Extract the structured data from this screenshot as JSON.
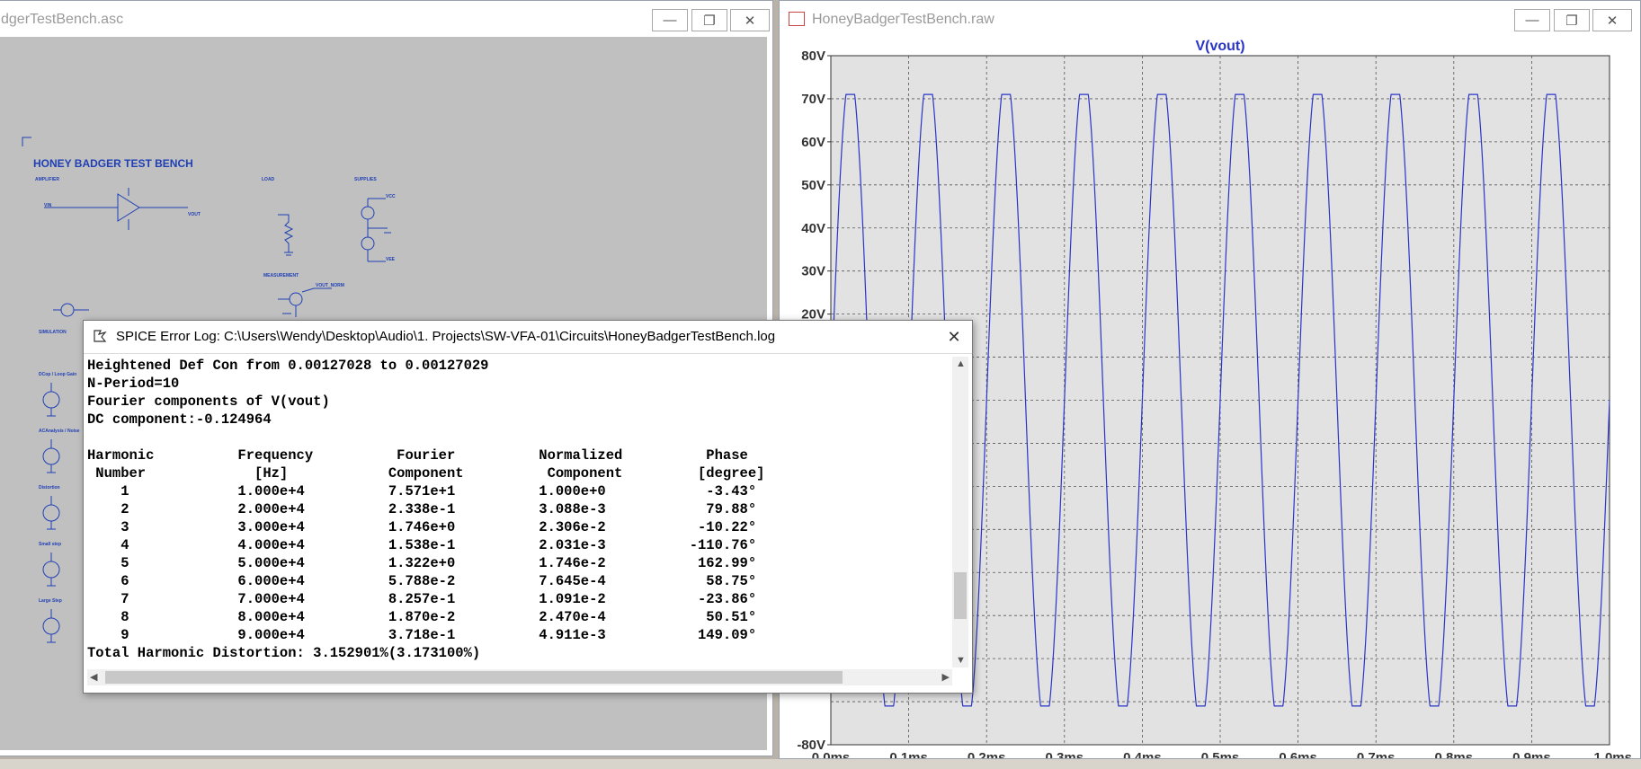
{
  "schematic_window": {
    "title": "dgerTestBench.asc",
    "texts": {
      "main_title": "HONEY BADGER TEST BENCH",
      "amplifier": "AMPLIFIER",
      "load": "LOAD",
      "supplies": "SUPPLIES",
      "measurement": "MEASUREMENT",
      "simulation": "SIMULATION",
      "dc_op": "DCop / Loop Gain",
      "ac_analysis": "ACAnalysis / Noise",
      "distortion": "Distortion",
      "small_step": "Small step",
      "large_step": "Large Step",
      "vin": "VIN",
      "vout": "VOUT",
      "vcc": "VCC",
      "vee": "VEE",
      "vout_norm": "VOUT_NORM"
    }
  },
  "waveform_window": {
    "title": "HoneyBadgerTestBench.raw",
    "trace_label": "V(vout)",
    "colors": {
      "trace": "#2a35c8",
      "label": "#2a35c8",
      "grid": "#555555",
      "plot_bg": "#e2e2e2"
    }
  },
  "chart_data": {
    "type": "line",
    "title": "V(vout)",
    "xlabel": "",
    "ylabel": "",
    "x_ticks": [
      "0.0ms",
      "0.1ms",
      "0.2ms",
      "0.3ms",
      "0.4ms",
      "0.5ms",
      "0.6ms",
      "0.7ms",
      "0.8ms",
      "0.9ms",
      "1.0ms"
    ],
    "y_ticks": [
      "80V",
      "70V",
      "60V",
      "50V",
      "40V",
      "30V",
      "20V",
      "-80V"
    ],
    "xlim": [
      0,
      1.0
    ],
    "ylim": [
      -80,
      80
    ],
    "grid": true,
    "series": [
      {
        "frequency_hz": 10000,
        "amplitude_v": 75.71,
        "clip_high_v": 71,
        "clip_low_v": -71,
        "color": "#2a35c8"
      }
    ]
  },
  "log_window": {
    "title": "SPICE Error Log: C:\\Users\\Wendy\\Desktop\\Audio\\1. Projects\\SW-VFA-01\\Circuits\\HoneyBadgerTestBench.log",
    "lines": [
      "Heightened Def Con from 0.00127028 to 0.00127029",
      "N-Period=10",
      "Fourier components of V(vout)",
      "DC component:-0.124964",
      "",
      "Harmonic          Frequency          Fourier          Normalized          Phase           ",
      " Number             [Hz]            Component          Component         [degree]",
      "    1             1.000e+4          7.571e+1          1.000e+0            -3.43°",
      "    2             2.000e+4          2.338e-1          3.088e-3            79.88°",
      "    3             3.000e+4          1.746e+0          2.306e-2           -10.22°",
      "    4             4.000e+4          1.538e-1          2.031e-3          -110.76°",
      "    5             5.000e+4          1.322e+0          1.746e-2           162.99°",
      "    6             6.000e+4          5.788e-2          7.645e-4            58.75°",
      "    7             7.000e+4          8.257e-1          1.091e-2           -23.86°",
      "    8             8.000e+4          1.870e-2          2.470e-4            50.51°",
      "    9             9.000e+4          3.718e-1          4.911e-3           149.09°",
      "Total Harmonic Distortion: 3.152901%(3.173100%)"
    ],
    "close_label": "✕"
  }
}
